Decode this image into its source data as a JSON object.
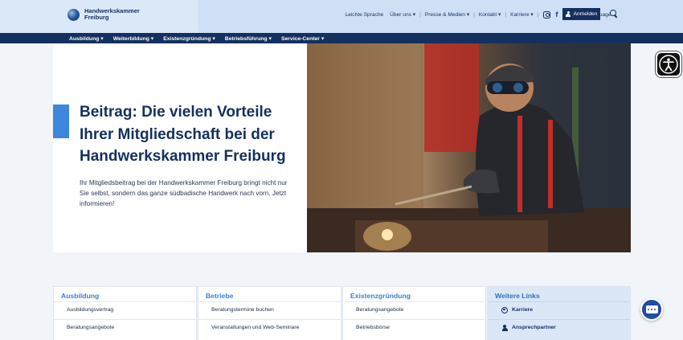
{
  "brand": {
    "name_line1": "Handwerkskammer",
    "name_line2": "Freiburg"
  },
  "utility_nav": [
    {
      "label": "Leichte Sprache"
    },
    {
      "label": "Über uns ▾"
    },
    {
      "label": "Presse & Medien ▾"
    },
    {
      "label": "Kontakt ▾"
    },
    {
      "label": "Karriere ▾"
    }
  ],
  "social": {
    "facebook": "f"
  },
  "language": {
    "label": "Language",
    "caret": "⌄"
  },
  "login": {
    "label": "Anmelden"
  },
  "main_nav": [
    {
      "label": "Ausbildung ▾"
    },
    {
      "label": "Weiterbildung ▾"
    },
    {
      "label": "Existenzgründung ▾"
    },
    {
      "label": "Betriebsführung ▾"
    },
    {
      "label": "Service-Center ▾"
    }
  ],
  "hero": {
    "title": "Beitrag: Die vielen Vorteile Ihrer Mitgliedschaft bei der Handwerkskammer Freiburg",
    "text": "Ihr Mitgliedsbeitrag bei der Handwerkskammer Freiburg bringt nicht nur Sie selbst, sondern das ganze südbadische Handwerk nach vorn. Jetzt informieren!"
  },
  "cards": [
    {
      "title": "Ausbildung",
      "items": [
        "Ausbildungsvertrag",
        "Beratungsangebote"
      ]
    },
    {
      "title": "Betriebe",
      "items": [
        "Beratungstermine buchen",
        "Veranstaltungen und Web-Seminare"
      ]
    },
    {
      "title": "Existenzgründung",
      "items": [
        "Beratungsangebote",
        "Betriebsbörse"
      ]
    },
    {
      "title": "Weitere Links",
      "items": [
        "Karriere",
        "Ansprechpartner"
      ]
    }
  ],
  "colors": {
    "navy": "#14305e",
    "accent": "#3d86dc",
    "header_bg": "#cfe0f6"
  }
}
